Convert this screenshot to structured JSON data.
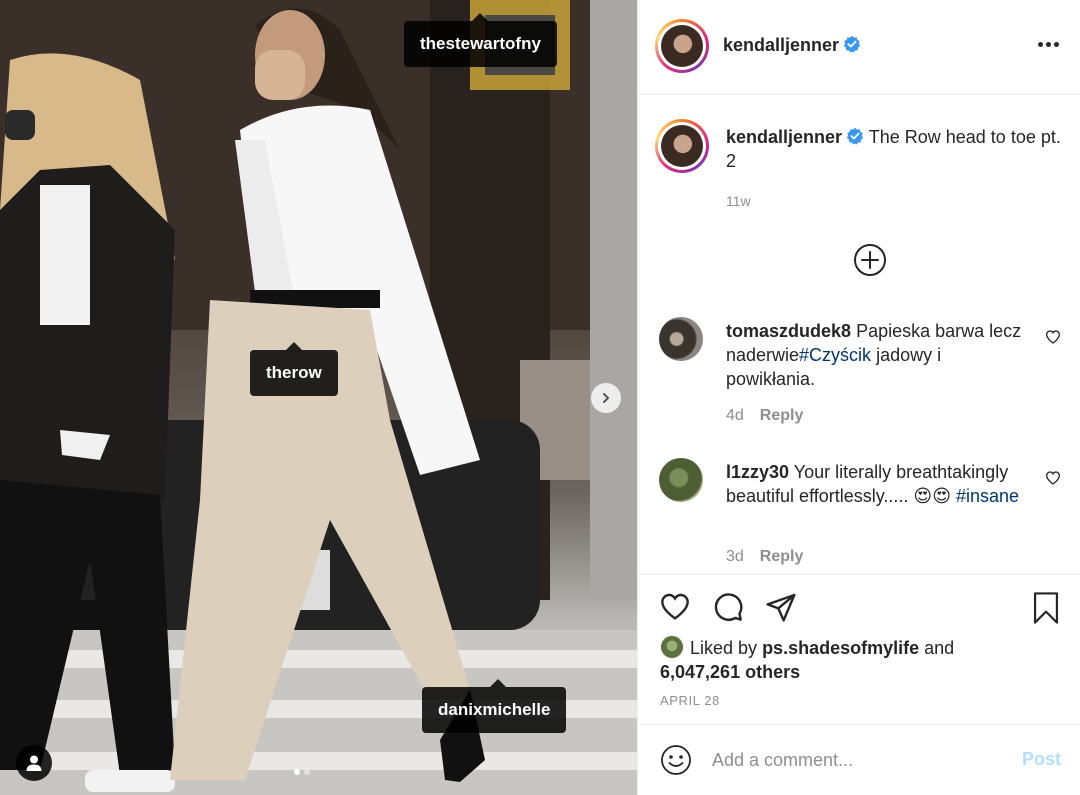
{
  "photo": {
    "tags": [
      "thestewartofny",
      "therow",
      "danixmichelle"
    ],
    "next_icon": "chevron-right-icon",
    "user_tag_icon": "user-icon",
    "carousel_slides": 2,
    "carousel_active": 1
  },
  "post": {
    "author": "kendalljenner",
    "verified": true,
    "caption": "The Row head to toe pt. 2",
    "time_ago": "11w",
    "more_icon": "more-horizontal-icon",
    "load_more_icon": "plus-circle-icon"
  },
  "comments": [
    {
      "username": "tomaszdudek8",
      "text_before": "Papieska barwa lecz naderwie",
      "hashtag": "#Czyścik",
      "text_after": " jadowy i powikłania.",
      "time": "4d",
      "reply_label": "Reply"
    },
    {
      "username": "l1zzy30",
      "text_before": "Your literally breathtakingly beautiful effortlessly..... 😍😍 ",
      "hashtag": "#insane",
      "text_after": "",
      "time": "3d",
      "reply_label": "Reply"
    }
  ],
  "likes": {
    "prefix": "Liked by",
    "user": "ps.shadesofmylife",
    "and": "and",
    "others": "6,047,261 others"
  },
  "date": "APRIL 28",
  "comment_box": {
    "placeholder": "Add a comment...",
    "post_label": "Post"
  },
  "colors": {
    "link": "#00376b",
    "verified": "#3897f0",
    "post_disabled": "#b2dffc",
    "muted": "#8e8e8e"
  }
}
